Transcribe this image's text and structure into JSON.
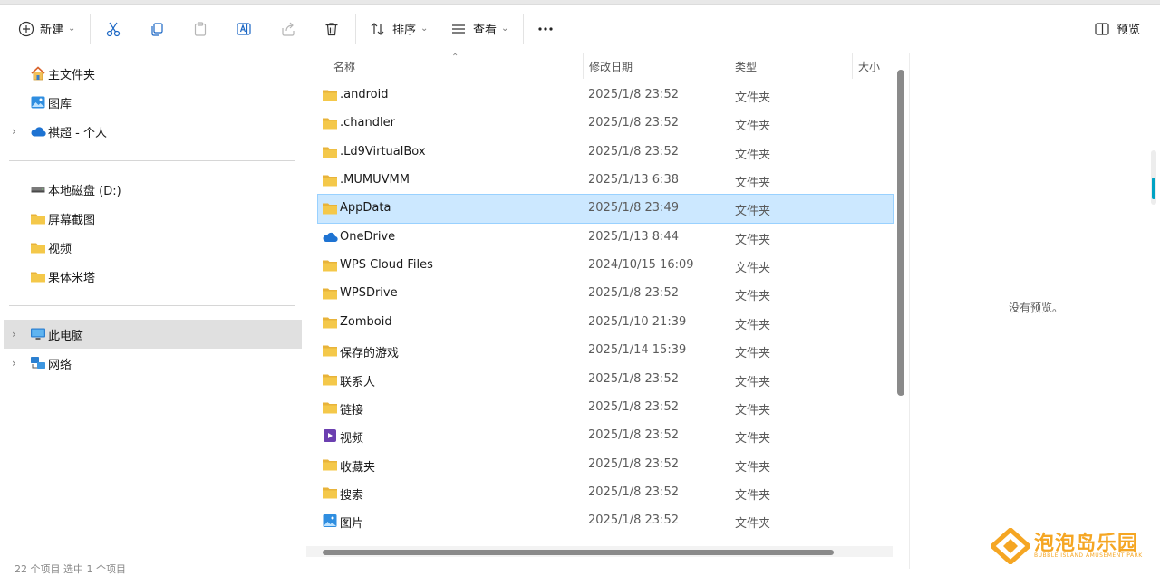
{
  "toolbar": {
    "new_label": "新建",
    "sort_label": "排序",
    "view_label": "查看",
    "preview_label": "预览",
    "icons": [
      "plus-circle-icon",
      "cut-icon",
      "copy-icon",
      "paste-icon",
      "rename-icon",
      "share-icon",
      "delete-icon",
      "sort-icon",
      "view-icon",
      "more-icon",
      "preview-pane-icon"
    ]
  },
  "nav": {
    "items": [
      {
        "label": "主文件夹",
        "icon": "home-icon"
      },
      {
        "label": "图库",
        "icon": "gallery-icon"
      },
      {
        "label": "祺超 - 个人",
        "icon": "onedrive-icon"
      },
      {
        "label": "本地磁盘 (D:)",
        "icon": "drive-icon"
      },
      {
        "label": "屏幕截图",
        "icon": "folder-icon"
      },
      {
        "label": "视频",
        "icon": "folder-icon"
      },
      {
        "label": "果体米塔",
        "icon": "folder-icon"
      },
      {
        "label": "此电脑",
        "icon": "pc-icon"
      },
      {
        "label": "网络",
        "icon": "network-icon"
      }
    ]
  },
  "columns": {
    "name": "名称",
    "date": "修改日期",
    "type": "类型",
    "size": "大小"
  },
  "files": [
    {
      "name": ".android",
      "date": "2025/1/8 23:52",
      "type": "文件夹",
      "icon": "folder-icon"
    },
    {
      "name": ".chandler",
      "date": "2025/1/8 23:52",
      "type": "文件夹",
      "icon": "folder-icon"
    },
    {
      "name": ".Ld9VirtualBox",
      "date": "2025/1/8 23:52",
      "type": "文件夹",
      "icon": "folder-icon"
    },
    {
      "name": ".MUMUVMM",
      "date": "2025/1/13 6:38",
      "type": "文件夹",
      "icon": "folder-icon"
    },
    {
      "name": "AppData",
      "date": "2025/1/8 23:49",
      "type": "文件夹",
      "icon": "folder-icon",
      "selected": true
    },
    {
      "name": "OneDrive",
      "date": "2025/1/13 8:44",
      "type": "文件夹",
      "icon": "onedrive-icon"
    },
    {
      "name": "WPS Cloud Files",
      "date": "2024/10/15 16:09",
      "type": "文件夹",
      "icon": "folder-icon"
    },
    {
      "name": "WPSDrive",
      "date": "2025/1/8 23:52",
      "type": "文件夹",
      "icon": "folder-icon"
    },
    {
      "name": "Zomboid",
      "date": "2025/1/10 21:39",
      "type": "文件夹",
      "icon": "folder-icon"
    },
    {
      "name": "保存的游戏",
      "date": "2025/1/14 15:39",
      "type": "文件夹",
      "icon": "folder-icon"
    },
    {
      "name": "联系人",
      "date": "2025/1/8 23:52",
      "type": "文件夹",
      "icon": "folder-icon"
    },
    {
      "name": "链接",
      "date": "2025/1/8 23:52",
      "type": "文件夹",
      "icon": "folder-icon"
    },
    {
      "name": "视频",
      "date": "2025/1/8 23:52",
      "type": "文件夹",
      "icon": "video-folder-icon"
    },
    {
      "name": "收藏夹",
      "date": "2025/1/8 23:52",
      "type": "文件夹",
      "icon": "folder-icon"
    },
    {
      "name": "搜索",
      "date": "2025/1/8 23:52",
      "type": "文件夹",
      "icon": "folder-icon"
    },
    {
      "name": "图片",
      "date": "2025/1/8 23:52",
      "type": "文件夹",
      "icon": "pictures-folder-icon"
    }
  ],
  "preview_text": "没有预览。",
  "status_text": "22 个项目    选中 1 个项目",
  "watermark": {
    "title": "泡泡岛乐园",
    "subtitle": "BUBBLE ISLAND AMUSEMENT PARK"
  },
  "colors": {
    "folder": "#f4c84a",
    "selection": "#cce8ff",
    "accent": "#0067c0",
    "watermark": "#f5a623"
  }
}
